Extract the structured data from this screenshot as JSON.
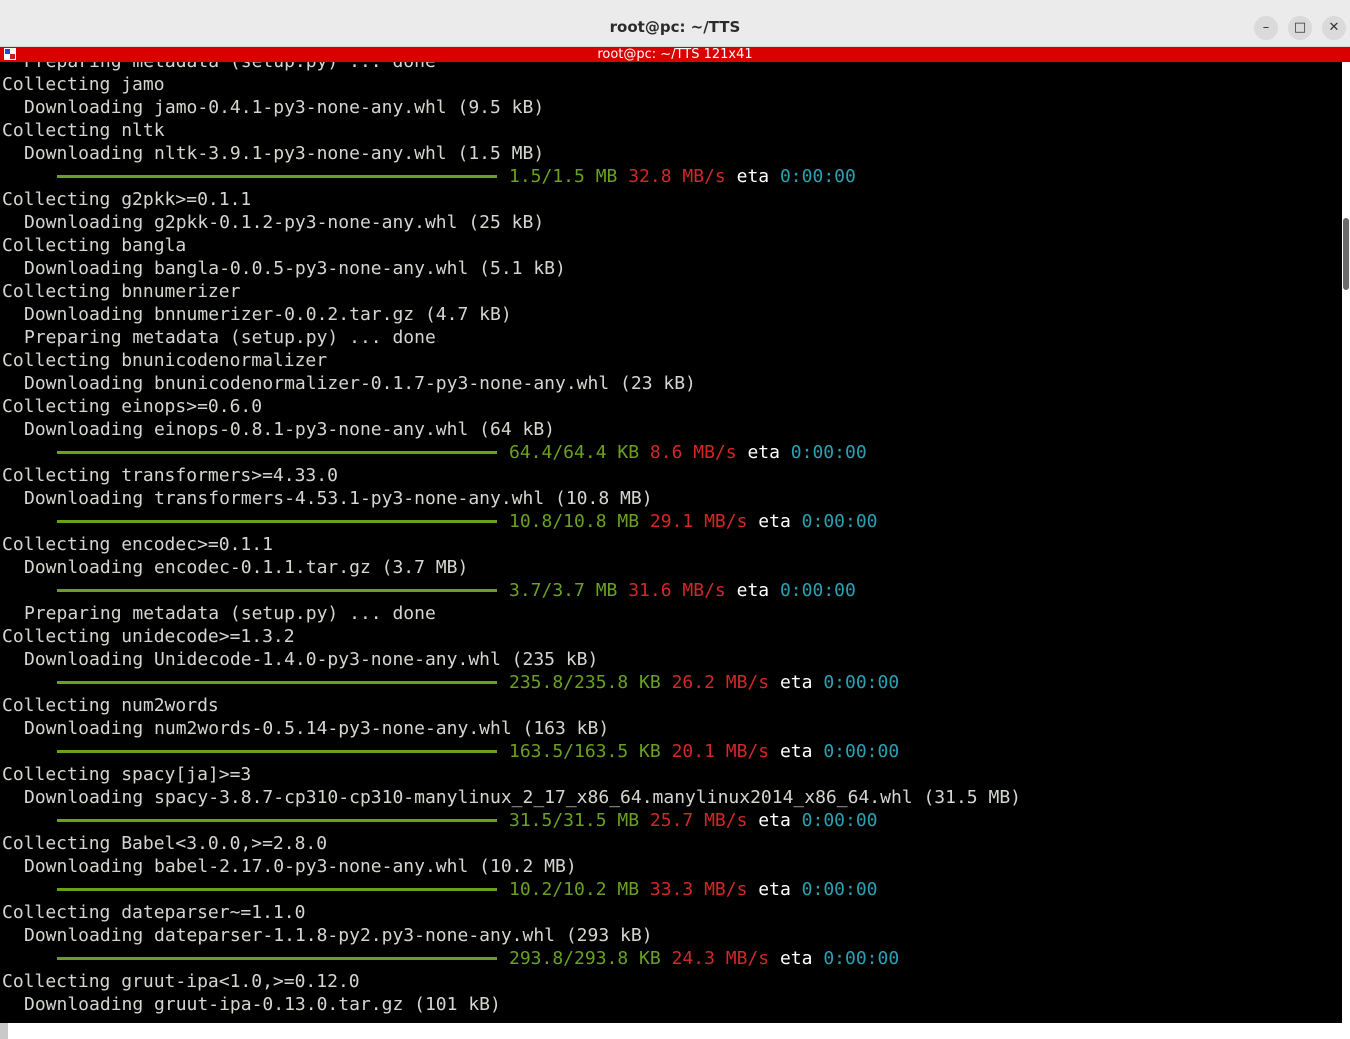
{
  "window": {
    "title": "root@pc: ~/TTS",
    "tab_title": "root@pc: ~/TTS 121x41",
    "minimize_glyph": "–",
    "maximize_glyph": "□",
    "close_glyph": "✕"
  },
  "colors": {
    "progress": "#6aa121",
    "speed": "#d22828",
    "eta": "#2aa1b3",
    "tab_bar": "#d90000"
  },
  "terminal": {
    "lines": [
      {
        "indent": true,
        "text": "Preparing metadata (setup.py) ... done"
      },
      {
        "indent": false,
        "text": "Collecting jamo"
      },
      {
        "indent": true,
        "text": "Downloading jamo-0.4.1-py3-none-any.whl (9.5 kB)"
      },
      {
        "indent": false,
        "text": "Collecting nltk"
      },
      {
        "indent": true,
        "text": "Downloading nltk-3.9.1-py3-none-any.whl (1.5 MB)"
      },
      {
        "progress": {
          "size": "1.5/1.5 MB",
          "speed": "32.8 MB/s",
          "eta_label": "eta",
          "eta": "0:00:00"
        }
      },
      {
        "indent": false,
        "text": "Collecting g2pkk>=0.1.1"
      },
      {
        "indent": true,
        "text": "Downloading g2pkk-0.1.2-py3-none-any.whl (25 kB)"
      },
      {
        "indent": false,
        "text": "Collecting bangla"
      },
      {
        "indent": true,
        "text": "Downloading bangla-0.0.5-py3-none-any.whl (5.1 kB)"
      },
      {
        "indent": false,
        "text": "Collecting bnnumerizer"
      },
      {
        "indent": true,
        "text": "Downloading bnnumerizer-0.0.2.tar.gz (4.7 kB)"
      },
      {
        "indent": true,
        "text": "Preparing metadata (setup.py) ... done"
      },
      {
        "indent": false,
        "text": "Collecting bnunicodenormalizer"
      },
      {
        "indent": true,
        "text": "Downloading bnunicodenormalizer-0.1.7-py3-none-any.whl (23 kB)"
      },
      {
        "indent": false,
        "text": "Collecting einops>=0.6.0"
      },
      {
        "indent": true,
        "text": "Downloading einops-0.8.1-py3-none-any.whl (64 kB)"
      },
      {
        "progress": {
          "size": "64.4/64.4 KB",
          "speed": "8.6 MB/s",
          "eta_label": "eta",
          "eta": "0:00:00"
        }
      },
      {
        "indent": false,
        "text": "Collecting transformers>=4.33.0"
      },
      {
        "indent": true,
        "text": "Downloading transformers-4.53.1-py3-none-any.whl (10.8 MB)"
      },
      {
        "progress": {
          "size": "10.8/10.8 MB",
          "speed": "29.1 MB/s",
          "eta_label": "eta",
          "eta": "0:00:00"
        }
      },
      {
        "indent": false,
        "text": "Collecting encodec>=0.1.1"
      },
      {
        "indent": true,
        "text": "Downloading encodec-0.1.1.tar.gz (3.7 MB)"
      },
      {
        "progress": {
          "size": "3.7/3.7 MB",
          "speed": "31.6 MB/s",
          "eta_label": "eta",
          "eta": "0:00:00"
        }
      },
      {
        "indent": true,
        "text": "Preparing metadata (setup.py) ... done"
      },
      {
        "indent": false,
        "text": "Collecting unidecode>=1.3.2"
      },
      {
        "indent": true,
        "text": "Downloading Unidecode-1.4.0-py3-none-any.whl (235 kB)"
      },
      {
        "progress": {
          "size": "235.8/235.8 KB",
          "speed": "26.2 MB/s",
          "eta_label": "eta",
          "eta": "0:00:00"
        }
      },
      {
        "indent": false,
        "text": "Collecting num2words"
      },
      {
        "indent": true,
        "text": "Downloading num2words-0.5.14-py3-none-any.whl (163 kB)"
      },
      {
        "progress": {
          "size": "163.5/163.5 KB",
          "speed": "20.1 MB/s",
          "eta_label": "eta",
          "eta": "0:00:00"
        }
      },
      {
        "indent": false,
        "text": "Collecting spacy[ja]>=3"
      },
      {
        "indent": true,
        "text": "Downloading spacy-3.8.7-cp310-cp310-manylinux_2_17_x86_64.manylinux2014_x86_64.whl (31.5 MB)"
      },
      {
        "progress": {
          "size": "31.5/31.5 MB",
          "speed": "25.7 MB/s",
          "eta_label": "eta",
          "eta": "0:00:00"
        }
      },
      {
        "indent": false,
        "text": "Collecting Babel<3.0.0,>=2.8.0"
      },
      {
        "indent": true,
        "text": "Downloading babel-2.17.0-py3-none-any.whl (10.2 MB)"
      },
      {
        "progress": {
          "size": "10.2/10.2 MB",
          "speed": "33.3 MB/s",
          "eta_label": "eta",
          "eta": "0:00:00"
        }
      },
      {
        "indent": false,
        "text": "Collecting dateparser~=1.1.0"
      },
      {
        "indent": true,
        "text": "Downloading dateparser-1.1.8-py2.py3-none-any.whl (293 kB)"
      },
      {
        "progress": {
          "size": "293.8/293.8 KB",
          "speed": "24.3 MB/s",
          "eta_label": "eta",
          "eta": "0:00:00"
        }
      },
      {
        "indent": false,
        "text": "Collecting gruut-ipa<1.0,>=0.12.0"
      },
      {
        "indent": true,
        "text": "Downloading gruut-ipa-0.13.0.tar.gz (101 kB)"
      }
    ]
  }
}
